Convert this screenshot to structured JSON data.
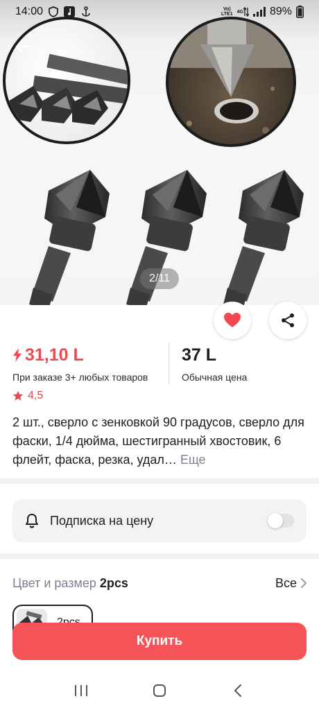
{
  "status_bar": {
    "time": "14:00",
    "net_top": "Vo)",
    "net_bottom": "LTE1",
    "net_type": "4G",
    "battery": "89%"
  },
  "gallery": {
    "page_indicator": "2/11",
    "back_icon": "arrow-left-icon",
    "favorite_icon": "heart-icon",
    "share_icon": "share-icon"
  },
  "price": {
    "promo_value": "31,10 L",
    "promo_caption": "При заказе 3+ любых товаров",
    "regular_value": "37 L",
    "regular_caption": "Обычная цена"
  },
  "rating": {
    "value": "4,5"
  },
  "product": {
    "title": "2 шт., сверло с зенковкой 90 градусов, сверло для фаски, 1/4 дюйма, шестигранный хвостовик, 6 флейт, фаска, резка, удал…",
    "more_label": "Еще"
  },
  "price_subscription": {
    "label": "Подписка на цену",
    "enabled": false
  },
  "variant": {
    "title": "Цвет и размер",
    "selected_value": "2pcs",
    "all_label": "Все",
    "chip_label": "2pcs"
  },
  "buy_button": {
    "label": "Купить"
  },
  "colors": {
    "accent": "#f7545a",
    "price_red": "#f2474f"
  }
}
